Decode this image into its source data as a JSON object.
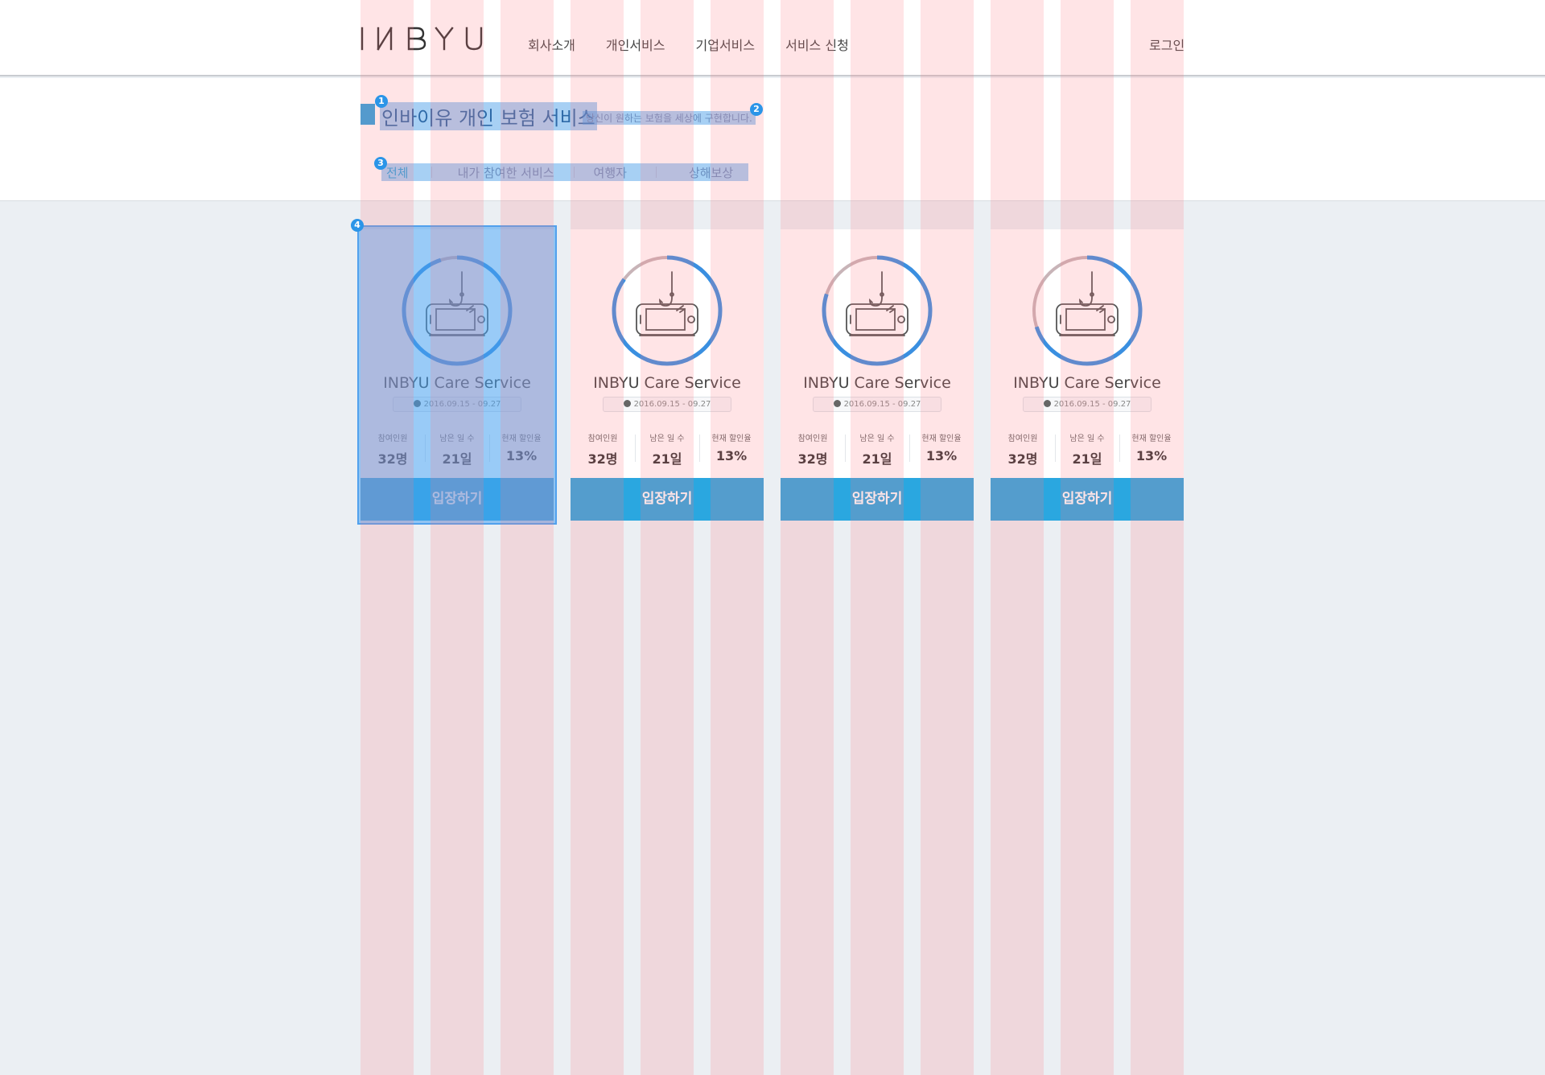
{
  "header": {
    "logo": "INBYU",
    "nav": [
      "회사소개",
      "개인서비스",
      "기업서비스",
      "서비스 신청"
    ],
    "login": "로그인"
  },
  "page": {
    "title": "인바이유 개인 보험 서비스",
    "subtitle": "당신이 원하는 보험을 세상에 구현합니다.",
    "tabs": [
      "전체",
      "내가 참여한 서비스",
      "여행자",
      "상해보상"
    ]
  },
  "markers": [
    "1",
    "2",
    "3",
    "4"
  ],
  "cards": [
    {
      "name": "INBYU Care Service",
      "date": "2016.09.15 - 09.27",
      "participants_label": "참여인원",
      "participants": "32명",
      "days_label": "남은 일 수",
      "days": "21일",
      "discount_label": "현재 할인율",
      "discount": "13%",
      "button": "입장하기",
      "progress": 0.95
    },
    {
      "name": "INBYU Care Service",
      "date": "2016.09.15 - 09.27",
      "participants_label": "참여인원",
      "participants": "32명",
      "days_label": "남은 일 수",
      "days": "21일",
      "discount_label": "현재 할인율",
      "discount": "13%",
      "button": "입장하기",
      "progress": 0.85
    },
    {
      "name": "INBYU Care Service",
      "date": "2016.09.15 - 09.27",
      "participants_label": "참여인원",
      "participants": "32명",
      "days_label": "남은 일 수",
      "days": "21일",
      "discount_label": "현재 할인율",
      "discount": "13%",
      "button": "입장하기",
      "progress": 0.8
    },
    {
      "name": "INBYU Care Service",
      "date": "2016.09.15 - 09.27",
      "participants_label": "참여인원",
      "participants": "32명",
      "days_label": "남은 일 수",
      "days": "21일",
      "discount_label": "현재 할인율",
      "discount": "13%",
      "button": "입장하기",
      "progress": 0.7
    }
  ],
  "colors": {
    "accent": "#2aa7e0",
    "ring": "#3a8fe0",
    "ring_track": "#c8b4b8"
  }
}
